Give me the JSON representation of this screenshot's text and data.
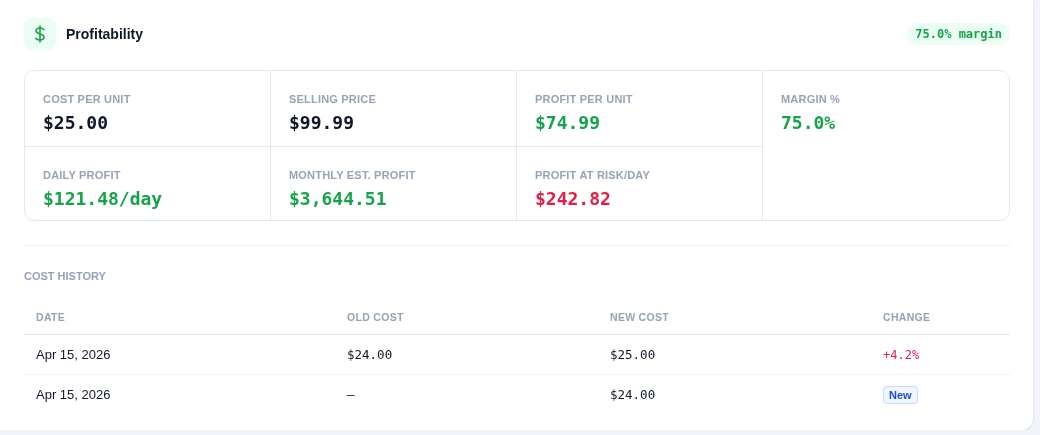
{
  "header": {
    "title": "Profitability",
    "badge": "75.0% margin"
  },
  "metrics": [
    {
      "label": "COST PER UNIT",
      "value": "$25.00",
      "color": "#0f172a"
    },
    {
      "label": "SELLING PRICE",
      "value": "$99.99",
      "color": "#0f172a"
    },
    {
      "label": "PROFIT PER UNIT",
      "value": "$74.99",
      "color": "#16a34a"
    },
    {
      "label": "MARGIN %",
      "value": "75.0%",
      "color": "#16a34a"
    },
    {
      "label": "DAILY PROFIT",
      "value": "$121.48/day",
      "color": "#16a34a"
    },
    {
      "label": "MONTHLY EST. PROFIT",
      "value": "$3,644.51",
      "color": "#16a34a"
    },
    {
      "label": "PROFIT AT RISK/DAY",
      "value": "$242.82",
      "color": "#e11d48"
    }
  ],
  "cost_history": {
    "title": "COST HISTORY",
    "columns": [
      "DATE",
      "OLD COST",
      "NEW COST",
      "CHANGE"
    ],
    "rows": [
      {
        "date": "Apr 15, 2026",
        "old_cost": "$24.00",
        "new_cost": "$25.00",
        "change": {
          "kind": "percent",
          "text": "+4.2%"
        }
      },
      {
        "date": "Apr 15, 2026",
        "old_cost": "—",
        "new_cost": "$24.00",
        "change": {
          "kind": "badge",
          "text": "New"
        }
      }
    ]
  }
}
